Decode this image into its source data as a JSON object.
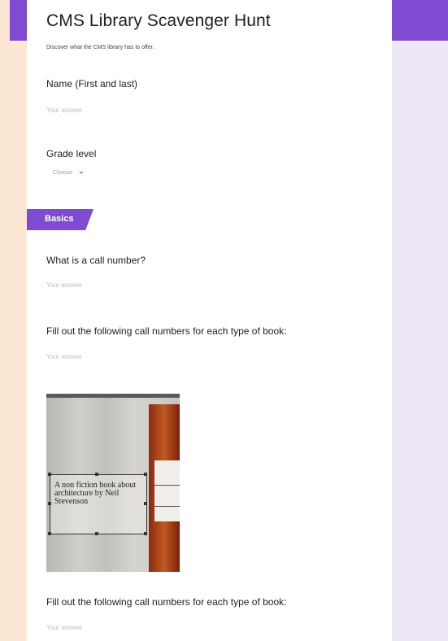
{
  "form": {
    "title": "CMS Library Scavenger Hunt",
    "description": "Discover what the CMS library has to offer.",
    "answer_placeholder": "Your answer"
  },
  "questions": {
    "name_label": "Name (First and last)",
    "grade_label": "Grade level",
    "grade_dropdown_value": "Choose",
    "call_number_label": "What is a call number?",
    "fill_call_numbers_label_1": "Fill out the following call numbers for each type of book:",
    "fill_call_numbers_label_2": "Fill out the following call numbers for each type of book:"
  },
  "section": {
    "title": "Basics"
  },
  "photo": {
    "label_text": "A non fiction book about architecture by Neil Stevenson"
  },
  "colors": {
    "accent": "#7f4bd1",
    "page_background": "#fbe7d3",
    "side_background": "#ede7f6"
  }
}
